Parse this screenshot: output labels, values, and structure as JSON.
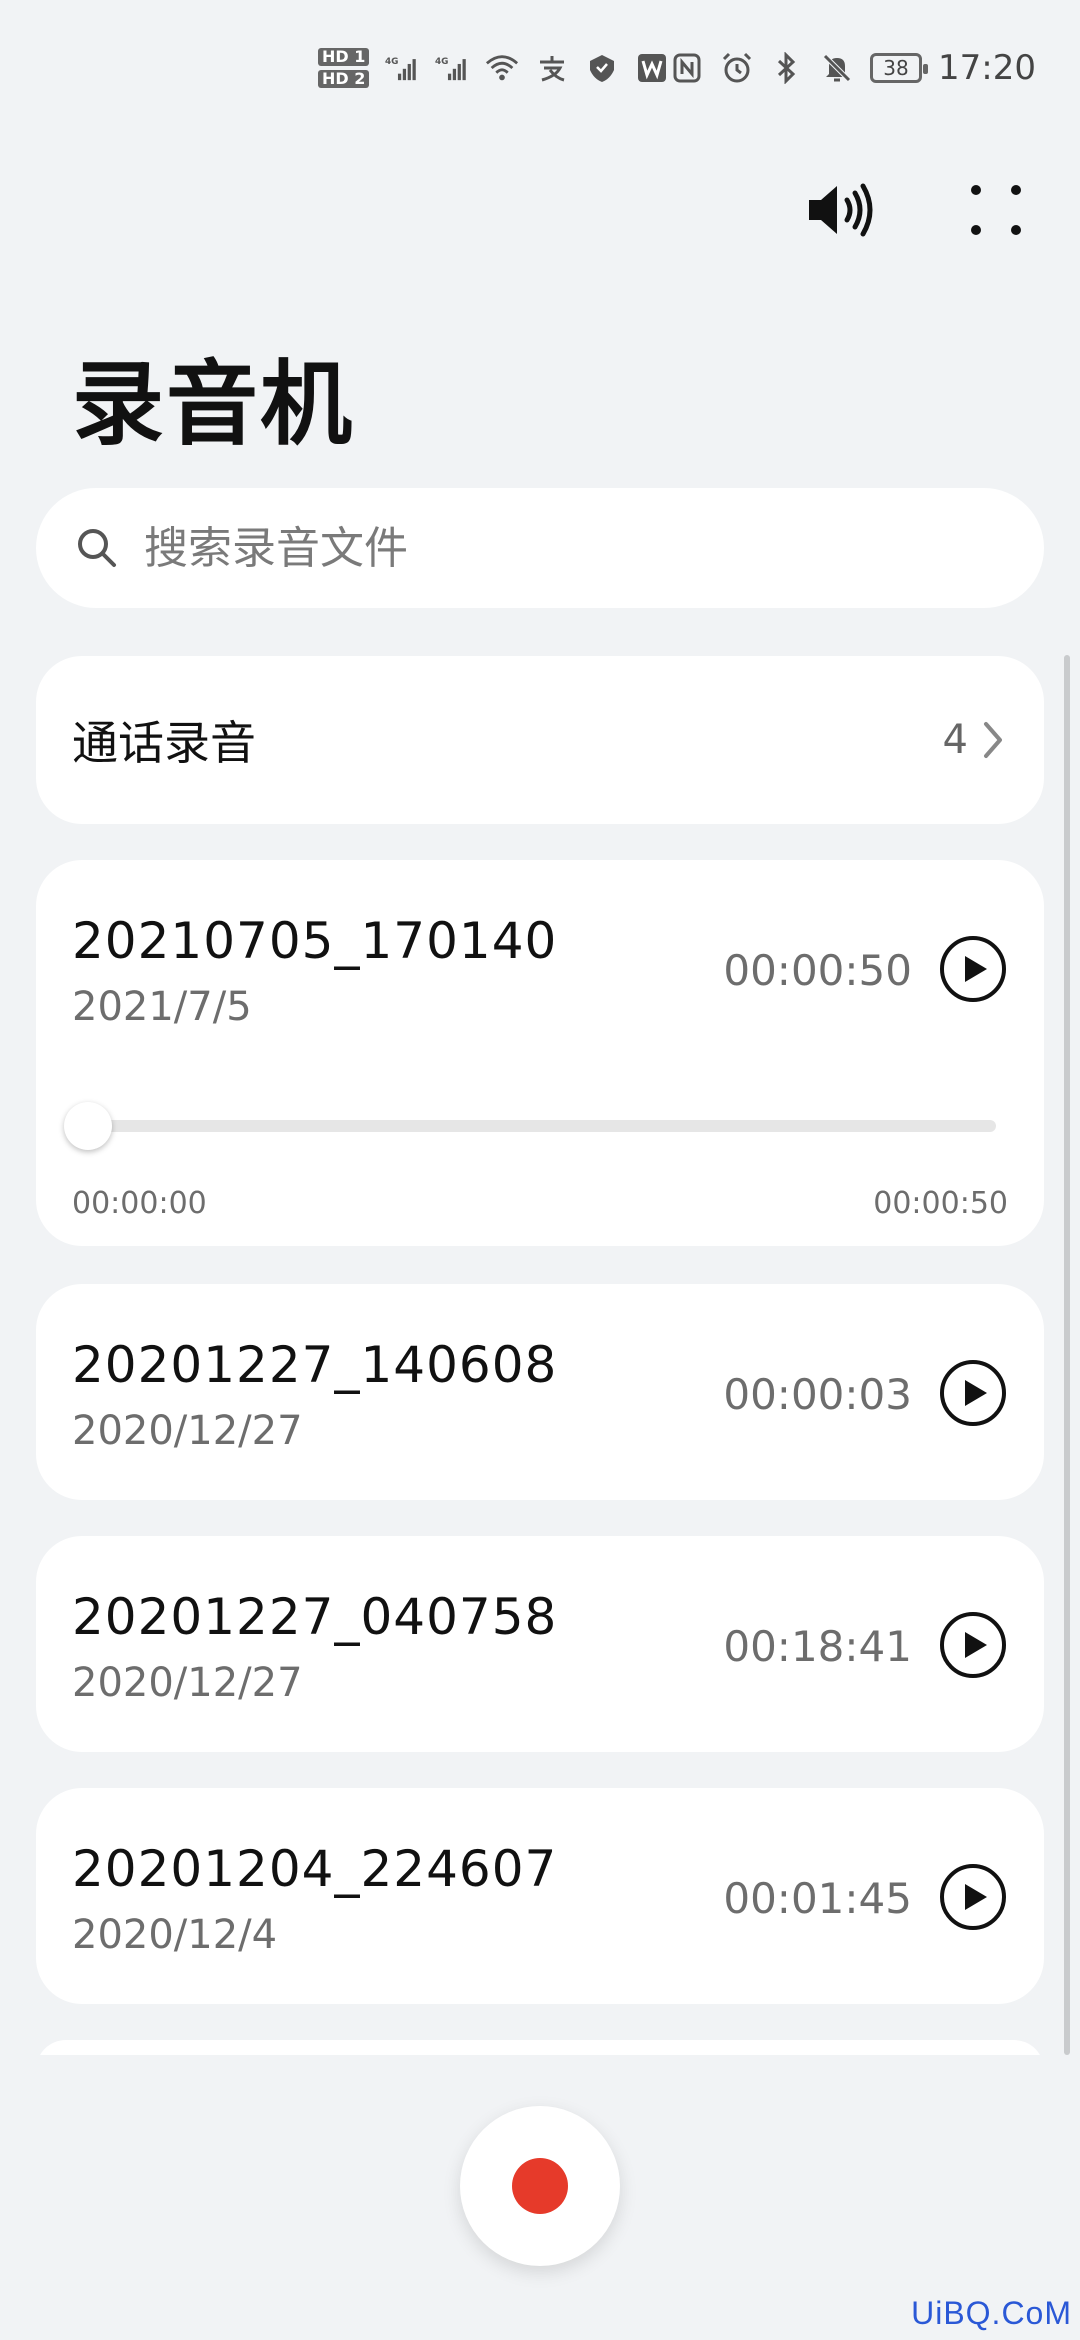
{
  "status_bar": {
    "hd1": "HD 1",
    "hd2": "HD 2",
    "net1": "4G",
    "net2": "4G",
    "battery": "38",
    "time": "17:20"
  },
  "toolbar": {
    "icons": [
      "speaker-icon",
      "more-icon"
    ]
  },
  "title": "录音机",
  "search": {
    "placeholder": "搜索录音文件",
    "icon": "search-icon"
  },
  "call_recordings": {
    "label": "通话录音",
    "count": "4"
  },
  "recordings": [
    {
      "title": "20210705_170140",
      "date": "2021/7/5",
      "duration": "00:00:50",
      "expanded": true,
      "position": "00:00:00",
      "total": "00:00:50",
      "progress": 0
    },
    {
      "title": "20201227_140608",
      "date": "2020/12/27",
      "duration": "00:00:03"
    },
    {
      "title": "20201227_040758",
      "date": "2020/12/27",
      "duration": "00:18:41"
    },
    {
      "title": "20201204_224607",
      "date": "2020/12/4",
      "duration": "00:01:45"
    }
  ],
  "record_button": {
    "color": "#e63a2a"
  },
  "watermark": "UiBQ.CoM"
}
